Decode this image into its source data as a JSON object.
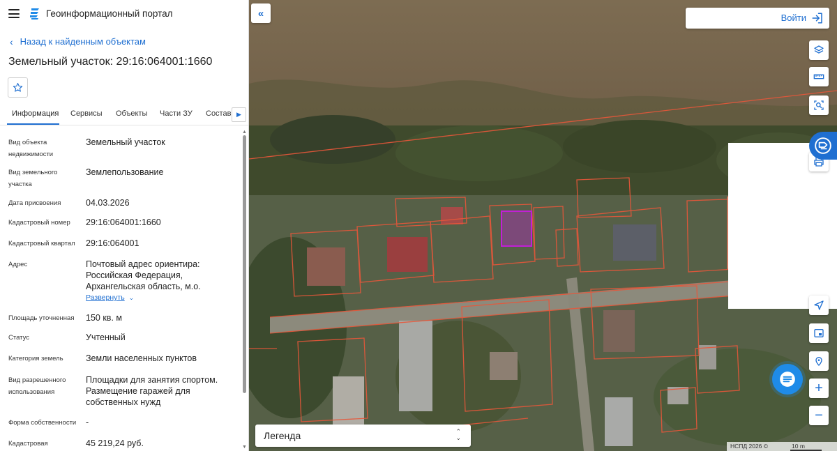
{
  "header": {
    "app_title": "Геоинформационный портал",
    "menu_icon": "menu-icon",
    "logo_icon": "portal-logo-icon"
  },
  "nav": {
    "back_label": "Назад к найденным объектам"
  },
  "object": {
    "title": "Земельный участок: 29:16:064001:1660"
  },
  "tabs": [
    {
      "label": "Информация",
      "active": true
    },
    {
      "label": "Сервисы",
      "active": false
    },
    {
      "label": "Объекты",
      "active": false
    },
    {
      "label": "Части ЗУ",
      "active": false
    },
    {
      "label": "Состав",
      "active": false
    }
  ],
  "properties": [
    {
      "label": "Вид объекта недвижимости",
      "value": "Земельный участок"
    },
    {
      "label": "Вид земельного участка",
      "value": "Землепользование"
    },
    {
      "label": "Дата присвоения",
      "value": "04.03.2026"
    },
    {
      "label": "Кадастровый номер",
      "value": "29:16:064001:1660"
    },
    {
      "label": "Кадастровый квартал",
      "value": "29:16:064001"
    },
    {
      "label": "Адрес",
      "value": "Почтовый адрес ориентира: Российская Федерация, Архангельская область, м.о."
    },
    {
      "label": "Площадь уточненная",
      "value": "150 кв. м"
    },
    {
      "label": "Статус",
      "value": "Учтенный"
    },
    {
      "label": "Категория земель",
      "value": "Земли населенных пунктов"
    },
    {
      "label": "Вид разрешенного использования",
      "value": "Площадки для занятия спортом. Размещение гаражей для собственных нужд"
    },
    {
      "label": "Форма собственности",
      "value": "-"
    },
    {
      "label": "Кадастровая",
      "value": "45 219,24 руб."
    }
  ],
  "address_expand_label": "Развернуть",
  "map": {
    "login_label": "Войти",
    "legend_label": "Легенда",
    "attribution": "НСПД 2026 ©",
    "scale_label": "10 m",
    "tools": [
      "layers-icon",
      "ruler-icon",
      "select-area-icon",
      "print-icon",
      "locate-icon",
      "minimap-icon",
      "pin-icon",
      "zoom-in-icon",
      "zoom-out-icon"
    ],
    "parcel_color": "#e8573a",
    "selected_color": "#c21fd6",
    "accent": "#1f6fd1"
  }
}
